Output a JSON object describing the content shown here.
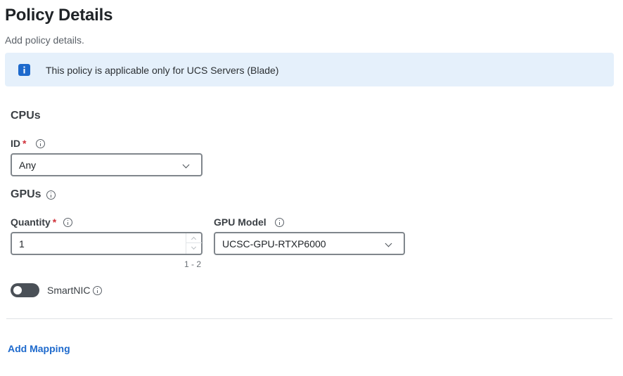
{
  "page": {
    "title": "Policy Details",
    "subtitle": "Add policy details."
  },
  "banner": {
    "icon": "info-icon",
    "text": "This policy is applicable only for UCS Servers (Blade)",
    "background": "#e5f0fb",
    "icon_color": "#1d69cc"
  },
  "cpus": {
    "section_title": "CPUs",
    "id_label": "ID",
    "required_marker": "*",
    "id_value": "Any"
  },
  "gpus": {
    "section_title": "GPUs",
    "quantity_label": "Quantity",
    "required_marker": "*",
    "quantity_value": "1",
    "quantity_range": "1 - 2",
    "model_label": "GPU Model",
    "model_value": "UCSC-GPU-RTXP6000"
  },
  "smartnic": {
    "label": "SmartNIC",
    "enabled": false
  },
  "actions": {
    "add_mapping": "Add Mapping",
    "link_color": "#1d69cc"
  }
}
